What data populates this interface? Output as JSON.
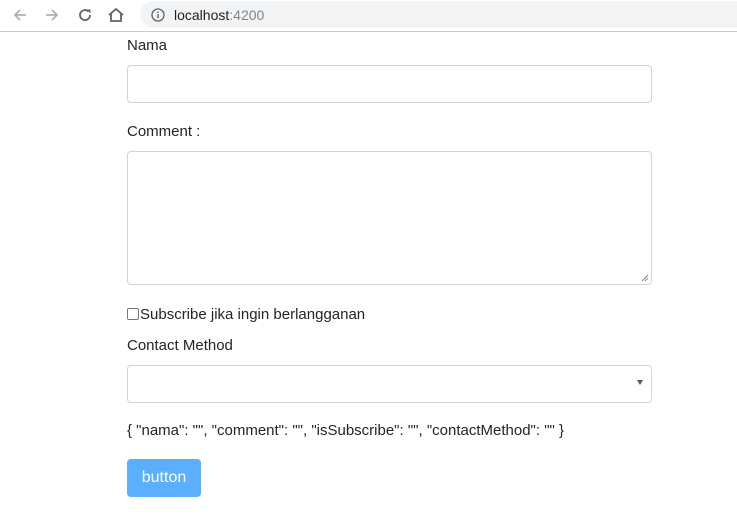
{
  "browser": {
    "url_host": "localhost",
    "url_port": ":4200",
    "icons": {
      "back": "back-arrow-icon",
      "forward": "forward-arrow-icon",
      "reload": "reload-icon",
      "home": "home-icon",
      "info": "info-icon"
    }
  },
  "form": {
    "nama_label": "Nama",
    "nama_value": "",
    "comment_label": "Comment :",
    "comment_value": "",
    "subscribe_label": "Subscribe jika ingin berlangganan",
    "subscribe_checked": false,
    "contact_label": "Contact Method",
    "contact_value": "",
    "json_output": "{ \"nama\": \"\", \"comment\": \"\", \"isSubscribe\": \"\", \"contactMethod\": \"\" }",
    "button_label": "button"
  },
  "colors": {
    "button_bg": "#5aafff",
    "border": "#ced4da",
    "text": "#212529"
  }
}
